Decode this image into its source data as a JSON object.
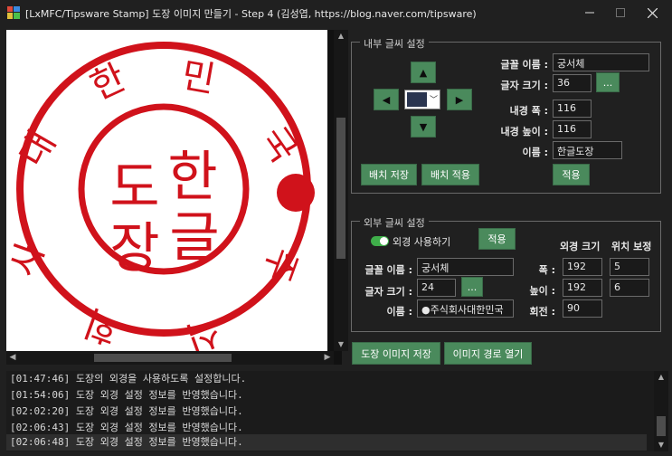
{
  "window": {
    "title": "[LxMFC/Tipsware Stamp] 도장 이미지 만들기 - Step 4 (김성엽, https://blog.naver.com/tipsware)",
    "minimize_icon": "minimize-icon",
    "maximize_icon": "maximize-icon",
    "close_icon": "close-icon"
  },
  "stamp": {
    "inner_text": [
      "도",
      "한",
      "장",
      "글"
    ],
    "outer_text": [
      "사",
      "대",
      "한",
      "민",
      "국",
      "주",
      "식",
      "회"
    ],
    "ring_color": "#d0121b"
  },
  "inner": {
    "group_title": "내부 글씨 설정",
    "font_name_label": "글꼴 이름 :",
    "font_name_value": "궁서체",
    "font_size_label": "글자 크기 :",
    "font_size_value": "36",
    "font_button": "...",
    "inner_width_label": "내경 폭 :",
    "inner_width_value": "116",
    "inner_height_label": "내경 높이 :",
    "inner_height_value": "116",
    "name_label": "이름 :",
    "name_value": "한글도장",
    "apply_button": "적용",
    "save_layout_button": "배치 저장",
    "apply_layout_button": "배치 적용",
    "arrow_up": "▲",
    "arrow_down": "▼",
    "arrow_left": "◀",
    "arrow_right": "▶",
    "combo_dropdown": "﹀"
  },
  "outer": {
    "group_title": "외부 글씨 설정",
    "use_outer_label": "외경 사용하기",
    "use_outer_enabled": true,
    "apply_button": "적용",
    "outer_size_header": "외경 크기",
    "position_header": "위치 보정",
    "font_name_label": "글꼴 이름 :",
    "font_name_value": "궁서체",
    "font_size_label": "글자 크기 :",
    "font_size_value": "24",
    "font_button": "...",
    "name_label": "이름 :",
    "name_value": "●주식회사대한민국",
    "width_label": "폭 :",
    "width_value": "192",
    "width_offset": "5",
    "height_label": "높이 :",
    "height_value": "192",
    "height_offset": "6",
    "rotate_label": "회전 :",
    "rotate_value": "90"
  },
  "actions": {
    "save_image": "도장 이미지 저장",
    "open_path": "이미지 경로 열기"
  },
  "log": [
    "[01:47:46] 도장의 외경을 사용하도록 설정합니다.",
    "[01:54:06] 도장 외경 설정 정보를 반영했습니다.",
    "[02:02:20] 도장 외경 설정 정보를 반영했습니다.",
    "[02:06:43] 도장 외경 설정 정보를 반영했습니다.",
    "[02:06:48] 도장 외경 설정 정보를 반영했습니다."
  ]
}
